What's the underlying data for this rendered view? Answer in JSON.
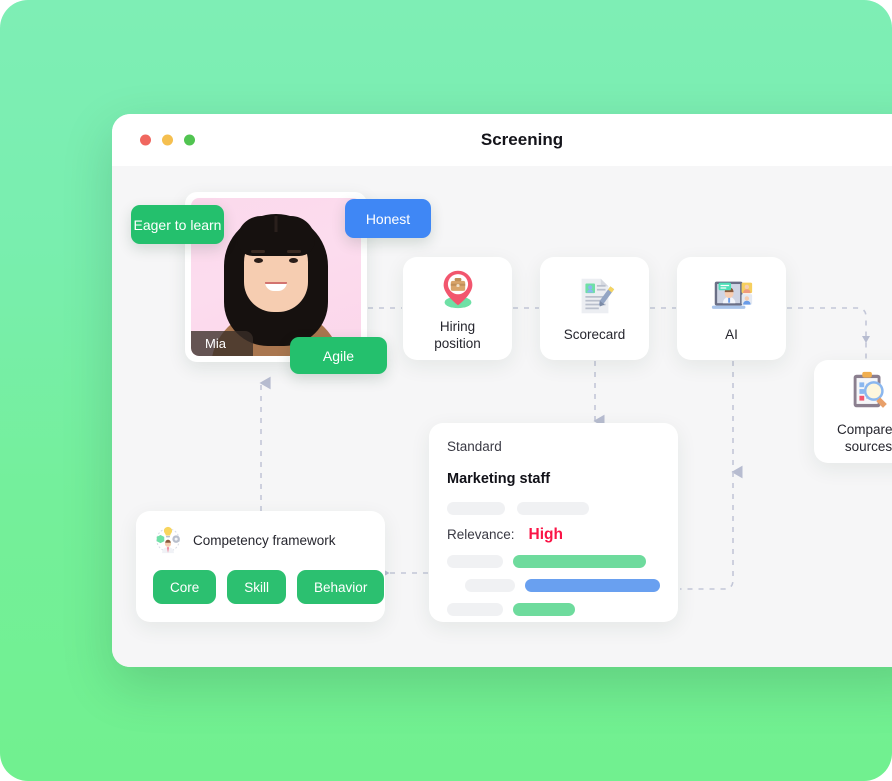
{
  "window": {
    "title": "Screening",
    "traffic_lights": [
      "close",
      "minimize",
      "maximize"
    ]
  },
  "candidate": {
    "name": "Mia",
    "tags": [
      {
        "label": "Eager to learn",
        "color": "#24c06d"
      },
      {
        "label": "Honest",
        "color": "#3f87f5"
      },
      {
        "label": "Agile",
        "color": "#24c06d"
      }
    ]
  },
  "pipeline": {
    "nodes": [
      {
        "id": "hiring-position",
        "label": "Hiring\nposition",
        "label_line1": "Hiring",
        "label_line2": "position",
        "icon": "map-pin-briefcase-icon"
      },
      {
        "id": "scorecard",
        "label": "Scorecard",
        "label_line1": "Scorecard",
        "label_line2": "",
        "icon": "document-pen-icon"
      },
      {
        "id": "ai",
        "label": "AI",
        "label_line1": "AI",
        "label_line2": "",
        "icon": "video-interview-icon"
      },
      {
        "id": "compared-sources",
        "label": "Compared sources",
        "label_line1": "Compared",
        "label_line2": "sources",
        "icon": "clipboard-magnifier-icon"
      }
    ]
  },
  "competency": {
    "title": "Competency framework",
    "icon": "competency-lightbulb-icon",
    "pills": [
      "Core",
      "Skill",
      "Behavior"
    ]
  },
  "standard": {
    "label": "Standard",
    "role": "Marketing staff",
    "relevance_label": "Relevance:",
    "relevance_value": "High",
    "relevance_color": "#fa1446",
    "bars": [
      {
        "color": "#6edb9d",
        "width_pct": 64
      },
      {
        "color": "#69a0f0",
        "width_pct": 76
      },
      {
        "color": "#6edb9d",
        "width_pct": 31
      }
    ]
  },
  "theme": {
    "background_top": "#7eeeb5",
    "background_bottom": "#71f08f",
    "accent_green": "#24c06d",
    "accent_blue": "#3f87f5",
    "canvas": "#f6f6f7"
  }
}
